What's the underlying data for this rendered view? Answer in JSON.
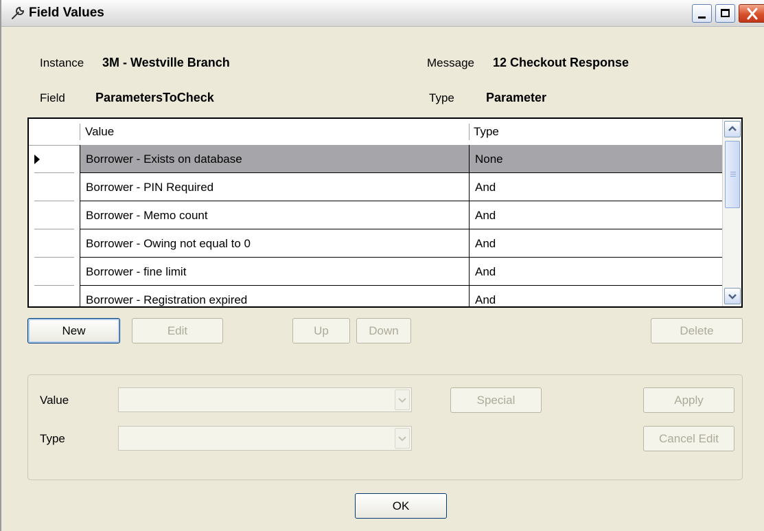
{
  "window": {
    "title": "Field Values",
    "controls": {
      "minimize_icon": "minimize-icon",
      "maximize_icon": "maximize-icon",
      "close_icon": "close-icon"
    }
  },
  "info": {
    "instance_label": "Instance",
    "instance_value": "3M - Westville Branch",
    "message_label": "Message",
    "message_value": "12 Checkout Response",
    "field_label": "Field",
    "field_value": "ParametersToCheck",
    "type_label": "Type",
    "type_value": "Parameter"
  },
  "grid": {
    "columns": [
      "Value",
      "Type"
    ],
    "rows": [
      {
        "value": "Borrower - Exists on database",
        "type": "None",
        "selected": true
      },
      {
        "value": "Borrower - PIN Required",
        "type": "And"
      },
      {
        "value": "Borrower - Memo count",
        "type": "And"
      },
      {
        "value": "Borrower - Owing not equal to 0",
        "type": "And"
      },
      {
        "value": "Borrower - fine limit",
        "type": "And"
      },
      {
        "value": "Borrower - Registration expired",
        "type": "And"
      }
    ]
  },
  "toolbar": {
    "new_label": "New",
    "edit_label": "Edit",
    "up_label": "Up",
    "down_label": "Down",
    "delete_label": "Delete"
  },
  "editor": {
    "value_label": "Value",
    "type_label": "Type",
    "value_selected": "",
    "type_selected": "",
    "special_label": "Special",
    "apply_label": "Apply",
    "cancel_label": "Cancel Edit"
  },
  "footer": {
    "ok_label": "OK"
  },
  "colors": {
    "window_bg": "#ECE9D8",
    "selected_row": "#A6A6AA",
    "disabled_text": "#ACAA98",
    "button_border": "#003C74"
  }
}
